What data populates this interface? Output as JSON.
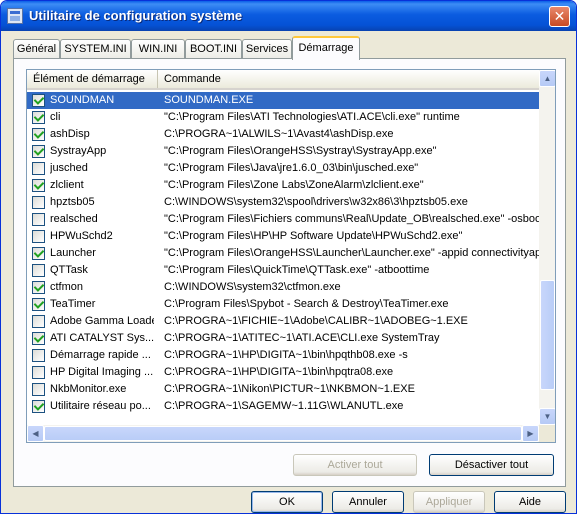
{
  "window": {
    "title": "Utilitaire de configuration système",
    "close_glyph": "✕"
  },
  "tabs": [
    {
      "label": "Général"
    },
    {
      "label": "SYSTEM.INI"
    },
    {
      "label": "WIN.INI"
    },
    {
      "label": "BOOT.INI"
    },
    {
      "label": "Services"
    },
    {
      "label": "Démarrage",
      "active": true
    }
  ],
  "list": {
    "columns": [
      "Élément de démarrage",
      "Commande"
    ],
    "rows": [
      {
        "checked": true,
        "selected": true,
        "name": "SOUNDMAN",
        "command": "SOUNDMAN.EXE"
      },
      {
        "checked": true,
        "name": "cli",
        "command": "\"C:\\Program Files\\ATI Technologies\\ATI.ACE\\cli.exe\" runtime"
      },
      {
        "checked": true,
        "name": "ashDisp",
        "command": "C:\\PROGRA~1\\ALWILS~1\\Avast4\\ashDisp.exe"
      },
      {
        "checked": true,
        "name": "SystrayApp",
        "command": "\"C:\\Program Files\\OrangeHSS\\Systray\\SystrayApp.exe\""
      },
      {
        "checked": false,
        "name": "jusched",
        "command": "\"C:\\Program Files\\Java\\jre1.6.0_03\\bin\\jusched.exe\""
      },
      {
        "checked": true,
        "name": "zlclient",
        "command": "\"C:\\Program Files\\Zone Labs\\ZoneAlarm\\zlclient.exe\""
      },
      {
        "checked": false,
        "name": "hpztsb05",
        "command": "C:\\WINDOWS\\system32\\spool\\drivers\\w32x86\\3\\hpztsb05.exe"
      },
      {
        "checked": false,
        "name": "realsched",
        "command": "\"C:\\Program Files\\Fichiers communs\\Real\\Update_OB\\realsched.exe\"  -osboot"
      },
      {
        "checked": false,
        "name": "HPWuSchd2",
        "command": "\"C:\\Program Files\\HP\\HP Software Update\\HPWuSchd2.exe\""
      },
      {
        "checked": true,
        "name": "Launcher",
        "command": "\"C:\\Program Files\\OrangeHSS\\Launcher\\Launcher.exe\" -appid connectivityapp"
      },
      {
        "checked": false,
        "name": "QTTask",
        "command": "\"C:\\Program Files\\QuickTime\\QTTask.exe\" -atboottime"
      },
      {
        "checked": true,
        "name": "ctfmon",
        "command": "C:\\WINDOWS\\system32\\ctfmon.exe"
      },
      {
        "checked": true,
        "name": "TeaTimer",
        "command": "C:\\Program Files\\Spybot - Search & Destroy\\TeaTimer.exe"
      },
      {
        "checked": false,
        "name": "Adobe Gamma Loader",
        "command": "C:\\PROGRA~1\\FICHIE~1\\Adobe\\CALIBR~1\\ADOBEG~1.EXE"
      },
      {
        "checked": true,
        "name": "ATI CATALYST Sys...",
        "command": "C:\\PROGRA~1\\ATITEC~1\\ATI.ACE\\CLI.exe SystemTray"
      },
      {
        "checked": false,
        "name": "Démarrage rapide ...",
        "command": "C:\\PROGRA~1\\HP\\DIGITA~1\\bin\\hpqthb08.exe -s"
      },
      {
        "checked": false,
        "name": "HP Digital Imaging ...",
        "command": "C:\\PROGRA~1\\HP\\DIGITA~1\\bin\\hpqtra08.exe"
      },
      {
        "checked": false,
        "name": "NkbMonitor.exe",
        "command": "C:\\PROGRA~1\\Nikon\\PICTUR~1\\NKBMON~1.EXE"
      },
      {
        "checked": true,
        "name": "Utilitaire réseau po...",
        "command": "C:\\PROGRA~1\\SAGEMW~1.11G\\WLANUTL.exe"
      }
    ]
  },
  "buttons": {
    "enable_all": "Activer tout",
    "disable_all": "Désactiver tout",
    "ok": "OK",
    "cancel": "Annuler",
    "apply": "Appliquer",
    "help": "Aide"
  },
  "scrollbar_glyphs": {
    "up": "▲",
    "down": "▼",
    "left": "◀",
    "right": "▶"
  }
}
